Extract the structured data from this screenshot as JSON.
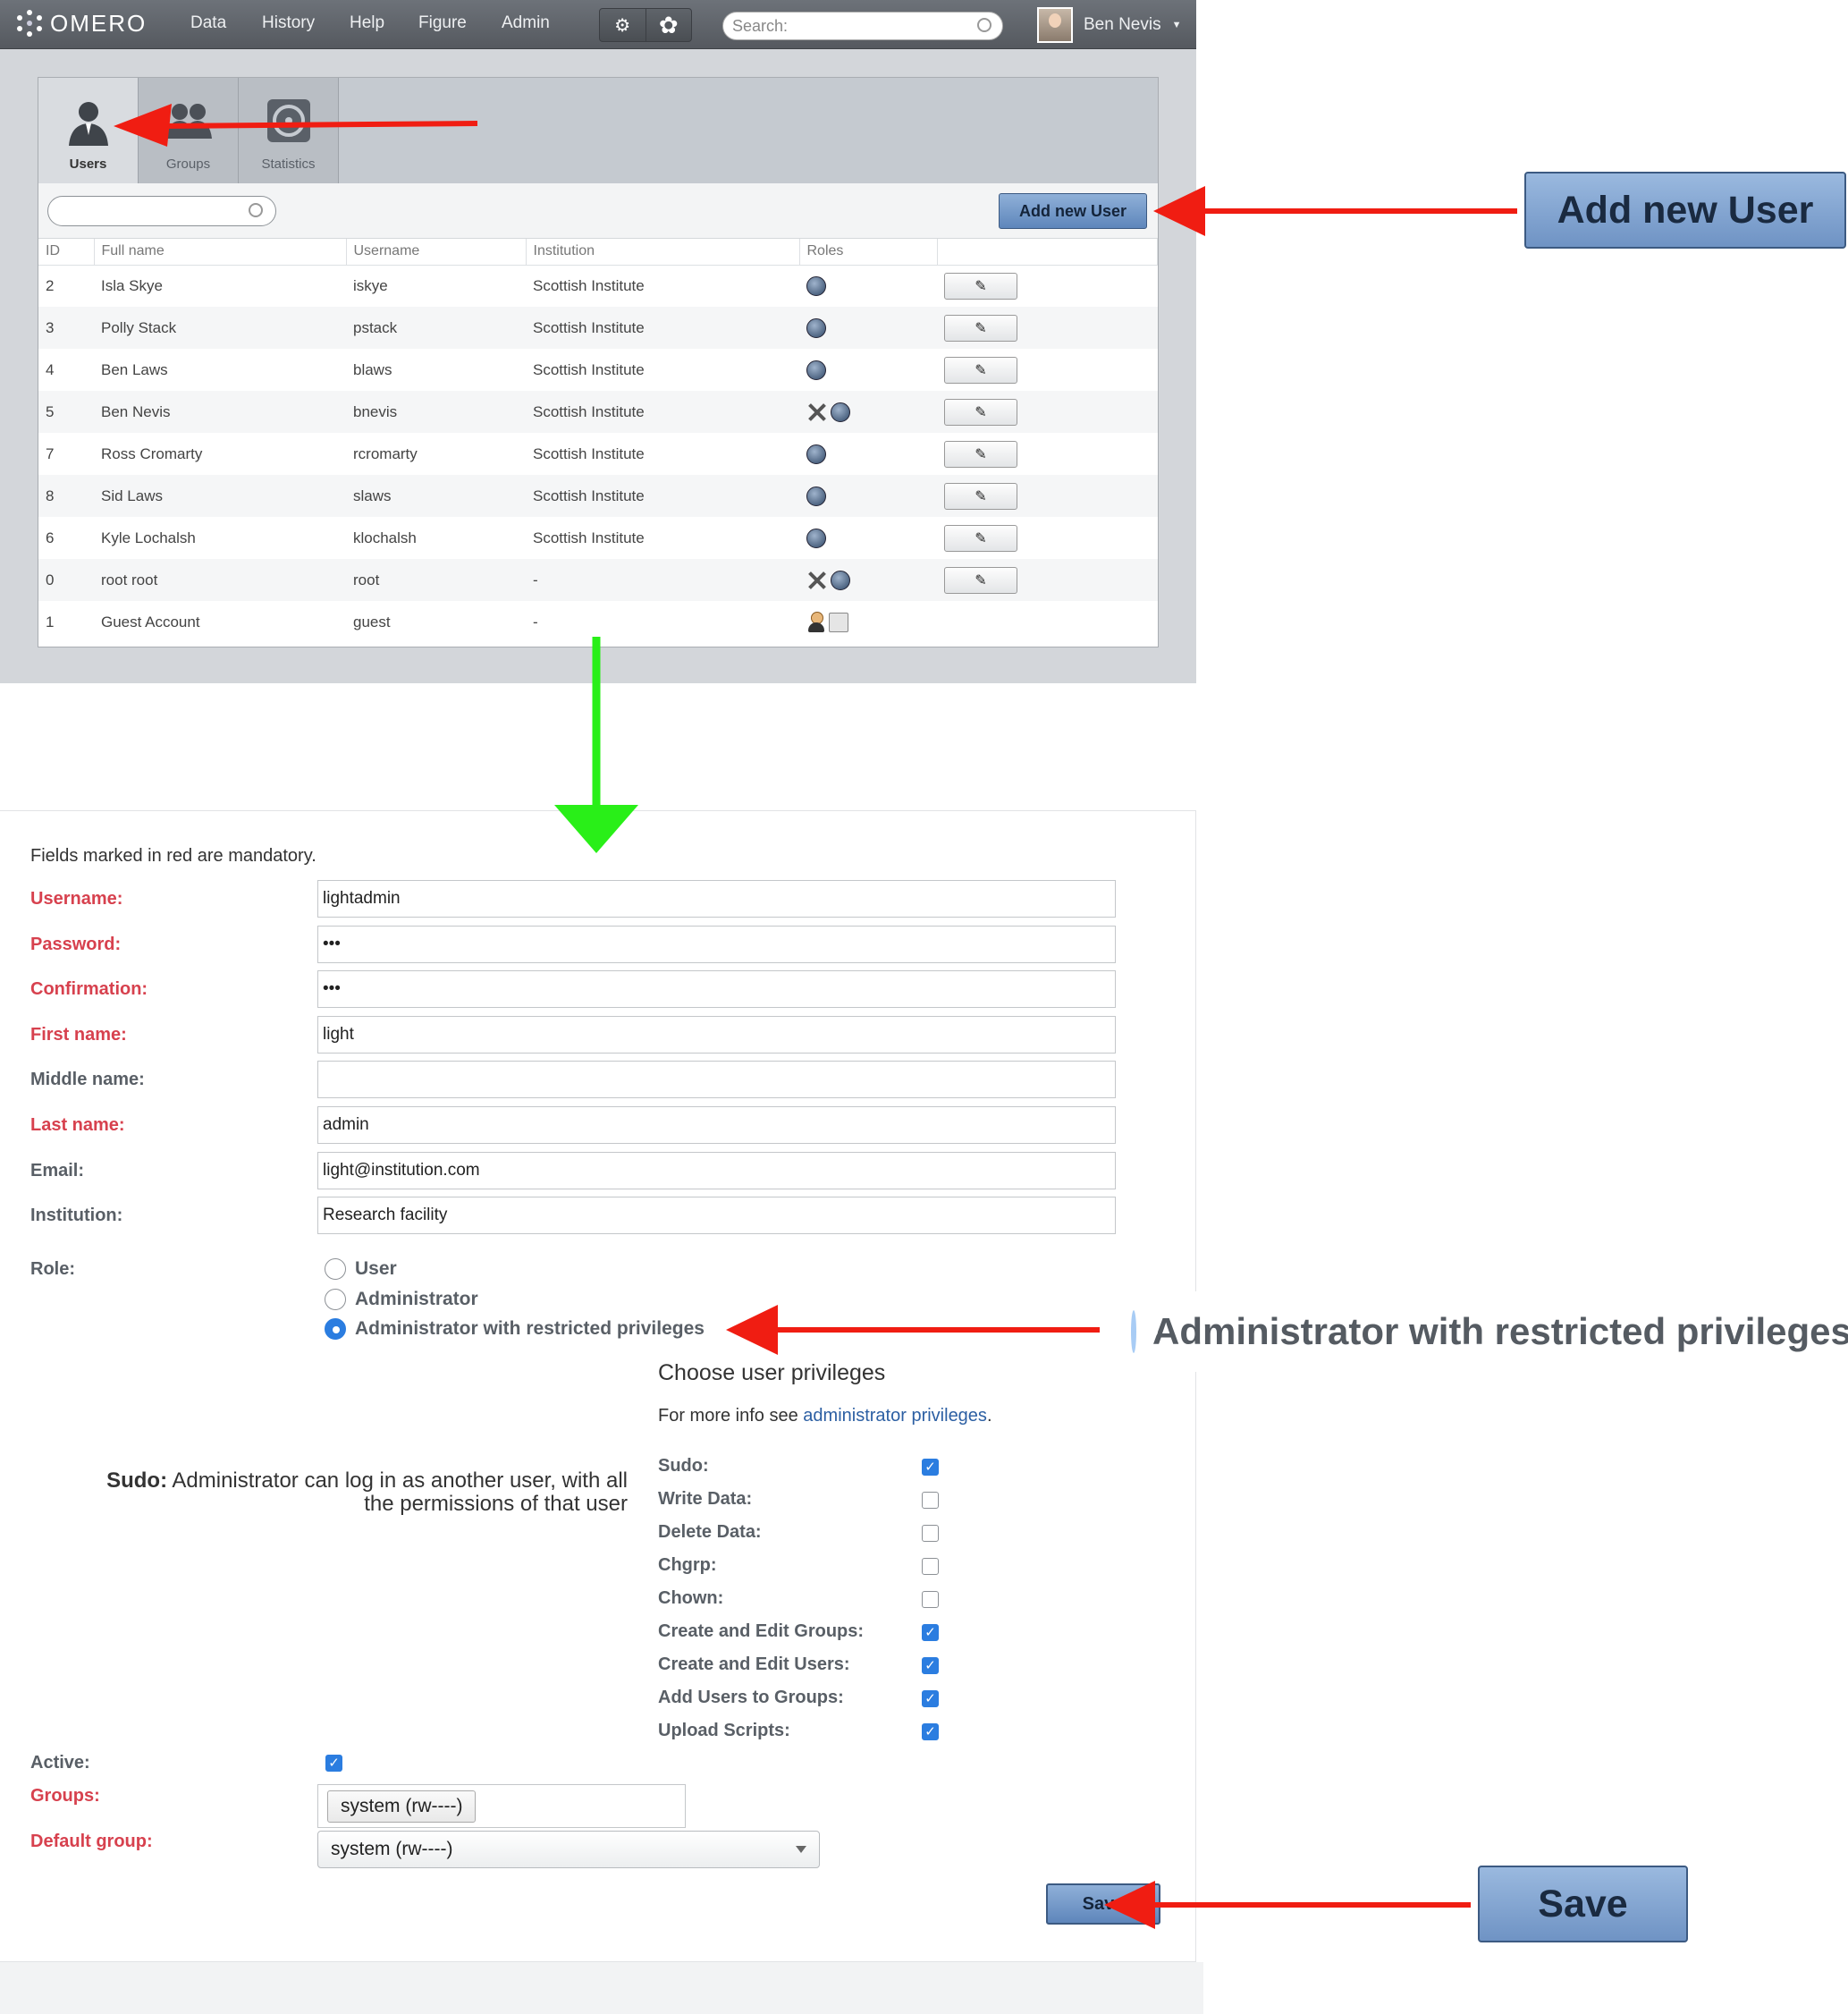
{
  "app": {
    "logo": "OMERO",
    "nav": [
      "Data",
      "History",
      "Help",
      "Figure",
      "Admin"
    ],
    "search_placeholder": "Search:",
    "user_name": "Ben Nevis"
  },
  "admin_tabs": [
    {
      "label": "Users",
      "icon": "user-icon",
      "active": true
    },
    {
      "label": "Groups",
      "icon": "groups-icon",
      "active": false
    },
    {
      "label": "Statistics",
      "icon": "statistics-icon",
      "active": false
    }
  ],
  "add_user_label": "Add new User",
  "table": {
    "headers": [
      "ID",
      "Full name",
      "Username",
      "Institution",
      "Roles",
      ""
    ],
    "rows": [
      {
        "id": "2",
        "full_name": "Isla Skye",
        "username": "iskye",
        "institution": "Scottish Institute",
        "roles": [
          "shield-icon"
        ],
        "editable": true
      },
      {
        "id": "3",
        "full_name": "Polly Stack",
        "username": "pstack",
        "institution": "Scottish Institute",
        "roles": [
          "shield-icon"
        ],
        "editable": true
      },
      {
        "id": "4",
        "full_name": "Ben Laws",
        "username": "blaws",
        "institution": "Scottish Institute",
        "roles": [
          "shield-icon"
        ],
        "editable": true
      },
      {
        "id": "5",
        "full_name": "Ben Nevis",
        "username": "bnevis",
        "institution": "Scottish Institute",
        "roles": [
          "tools-icon",
          "shield-icon"
        ],
        "editable": true
      },
      {
        "id": "7",
        "full_name": "Ross Cromarty",
        "username": "rcromarty",
        "institution": "Scottish Institute",
        "roles": [
          "shield-icon"
        ],
        "editable": true
      },
      {
        "id": "8",
        "full_name": "Sid Laws",
        "username": "slaws",
        "institution": "Scottish Institute",
        "roles": [
          "shield-icon"
        ],
        "editable": true
      },
      {
        "id": "6",
        "full_name": "Kyle Lochalsh",
        "username": "klochalsh",
        "institution": "Scottish Institute",
        "roles": [
          "shield-icon"
        ],
        "editable": true
      },
      {
        "id": "0",
        "full_name": "root root",
        "username": "root",
        "institution": "-",
        "roles": [
          "tools-icon",
          "shield-icon"
        ],
        "editable": true
      },
      {
        "id": "1",
        "full_name": "Guest Account",
        "username": "guest",
        "institution": "-",
        "roles": [
          "guest-icon",
          "lock-icon"
        ],
        "editable": false
      }
    ]
  },
  "form": {
    "note": "Fields marked in red are mandatory.",
    "fields": [
      {
        "key": "username",
        "label": "Username:",
        "value": "lightadmin",
        "required": true
      },
      {
        "key": "password",
        "label": "Password:",
        "value": "•••",
        "required": true
      },
      {
        "key": "confirmation",
        "label": "Confirmation:",
        "value": "•••",
        "required": true
      },
      {
        "key": "first_name",
        "label": "First name:",
        "value": "light",
        "required": true
      },
      {
        "key": "middle_name",
        "label": "Middle name:",
        "value": "",
        "required": false
      },
      {
        "key": "last_name",
        "label": "Last name:",
        "value": "admin",
        "required": true
      },
      {
        "key": "email",
        "label": "Email:",
        "value": "light@institution.com",
        "required": false
      },
      {
        "key": "institution",
        "label": "Institution:",
        "value": "Research facility",
        "required": false
      }
    ],
    "role_label": "Role:",
    "roles": [
      {
        "label": "User",
        "selected": false
      },
      {
        "label": "Administrator",
        "selected": false
      },
      {
        "label": "Administrator with restricted privileges",
        "selected": true
      }
    ],
    "privileges_title": "Choose user privileges",
    "privileges_info_prefix": "For more info see ",
    "privileges_info_link": "administrator privileges",
    "privileges_info_suffix": ".",
    "sudo_help_term": "Sudo:",
    "sudo_help_text": " Administrator can log in as another user, with all the permissions of that user",
    "privileges": [
      {
        "label": "Sudo:",
        "checked": true
      },
      {
        "label": "Write Data:",
        "checked": false
      },
      {
        "label": "Delete Data:",
        "checked": false
      },
      {
        "label": "Chgrp:",
        "checked": false
      },
      {
        "label": "Chown:",
        "checked": false
      },
      {
        "label": "Create and Edit Groups:",
        "checked": true
      },
      {
        "label": "Create and Edit Users:",
        "checked": true
      },
      {
        "label": "Add Users to Groups:",
        "checked": true
      },
      {
        "label": "Upload Scripts:",
        "checked": true
      }
    ],
    "active_label": "Active:",
    "active_checked": true,
    "groups_label": "Groups:",
    "groups": [
      "system (rw----)"
    ],
    "default_group_label": "Default group:",
    "default_group": "system (rw----)",
    "save_label": "Save"
  },
  "callouts": {
    "add_user": "Add new User",
    "role": "Administrator with restricted privileges",
    "save": "Save"
  },
  "colors": {
    "required_label": "#d7414e",
    "primary_button": "#6f93c4",
    "check_blue": "#2b7de0",
    "arrow_red": "#f01d12",
    "arrow_green": "#29ef18"
  }
}
